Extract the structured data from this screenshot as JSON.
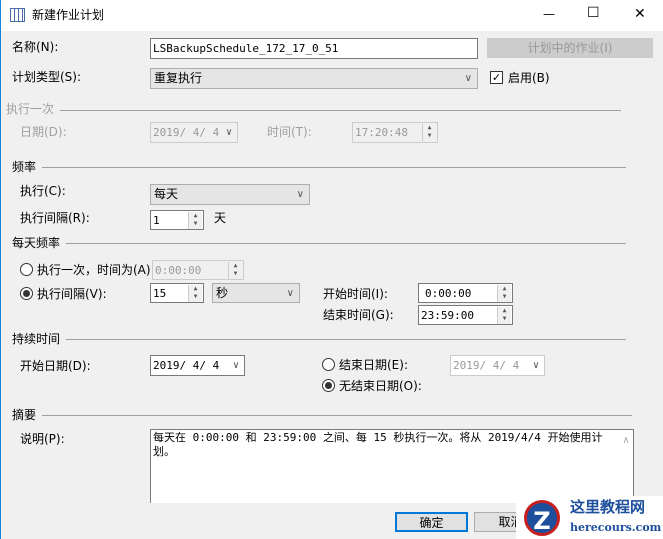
{
  "window": {
    "title": "新建作业计划",
    "minimize": "—",
    "maximize": "☐",
    "close": "✕"
  },
  "name": {
    "label": "名称(N):",
    "value": "LSBackupSchedule_172_17_0_51"
  },
  "jobs_button": "计划中的作业(I)",
  "schedule_type": {
    "label": "计划类型(S):",
    "value": "重复执行"
  },
  "enabled": {
    "label": "启用(B)",
    "checked": true
  },
  "one_time": {
    "group": "执行一次",
    "date_label": "日期(D):",
    "date": "2019/ 4/ 4",
    "time_label": "时间(T):",
    "time": "17:20:48"
  },
  "frequency": {
    "group": "频率",
    "occurs_label": "执行(C):",
    "occurs": "每天",
    "recurs_label": "执行间隔(R):",
    "recurs": "1",
    "recurs_unit": "天"
  },
  "daily": {
    "group": "每天频率",
    "once_label": "执行一次，时间为(A)",
    "once_time": "0:00:00",
    "every_label": "执行间隔(V):",
    "every_value": "15",
    "every_unit": "秒",
    "start_label": "开始时间(I):",
    "start": "0:00:00",
    "end_label": "结束时间(G):",
    "end": "23:59:00"
  },
  "duration": {
    "group": "持续时间",
    "start_label": "开始日期(D):",
    "start": "2019/ 4/ 4",
    "end_label": "结束日期(E):",
    "end": "2019/ 4/ 4",
    "no_end_label": "无结束日期(O):"
  },
  "summary": {
    "group": "摘要",
    "desc_label": "说明(P):",
    "text": "每天在 0:00:00 和 23:59:00 之间、每 15 秒执行一次。将从 2019/4/4 开始使用计划。"
  },
  "buttons": {
    "ok": "确定",
    "cancel": "取消"
  },
  "watermark": {
    "name": "这里教程网",
    "url": "herecours.com"
  }
}
